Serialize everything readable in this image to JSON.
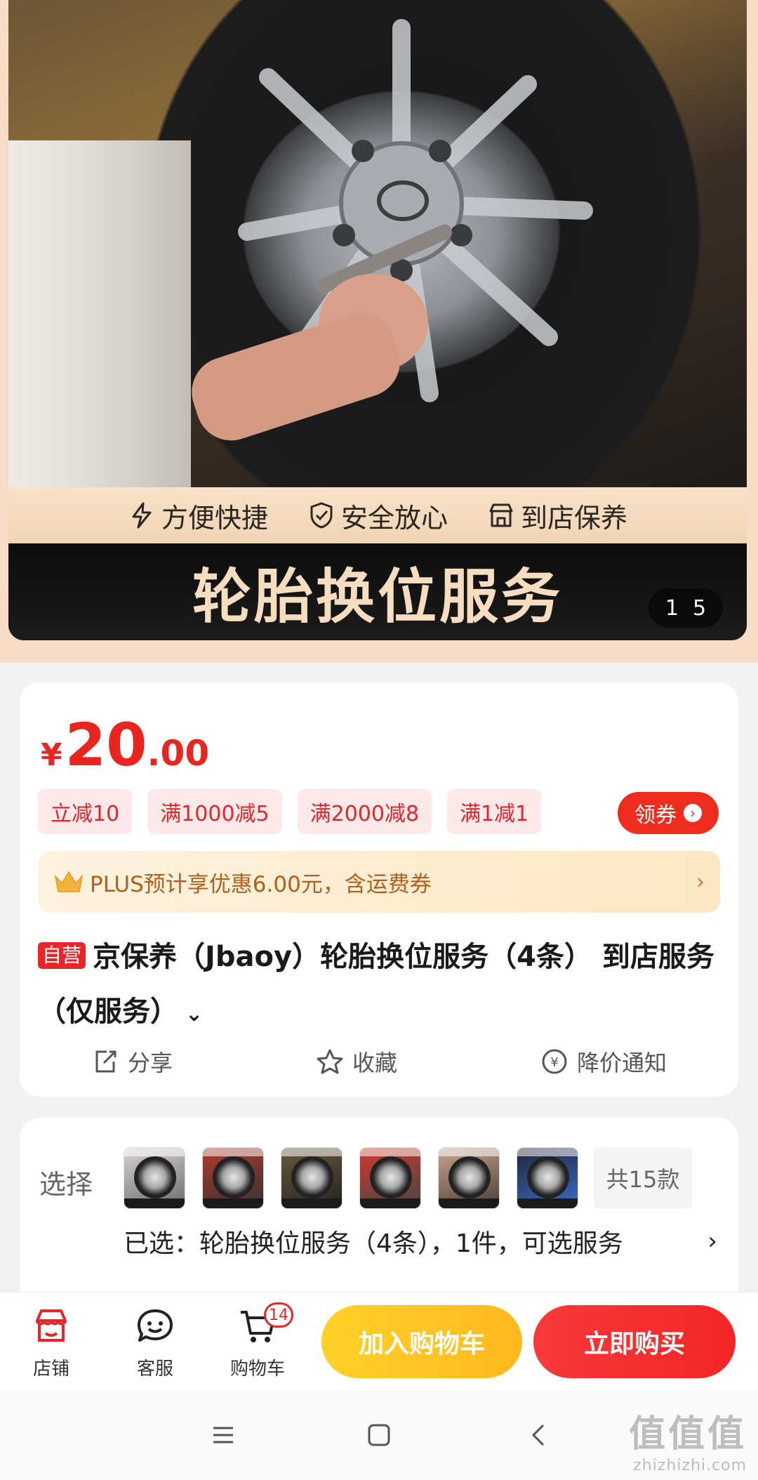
{
  "hero": {
    "features": [
      {
        "icon": "lightning-icon",
        "label": "方便快捷"
      },
      {
        "icon": "shield-check-icon",
        "label": "安全放心"
      },
      {
        "icon": "store-icon",
        "label": "到店保养"
      }
    ],
    "banner_title": "轮胎换位服务",
    "pager": {
      "current": "1",
      "total": "5"
    }
  },
  "price": {
    "currency": "¥",
    "integer": "20",
    "decimal": ".00"
  },
  "promotions": [
    "立减10",
    "满1000减5",
    "满2000减8",
    "满1减1"
  ],
  "coupon_button": {
    "label": "领券",
    "icon": "chevron-right-circle-icon"
  },
  "plus_bar": {
    "icon": "crown-icon",
    "text": "PLUS预计享优惠6.00元，含运费券",
    "chevron": "›"
  },
  "product": {
    "tag": "自营",
    "title": "京保养（Jbaoy）轮胎换位服务（4条） 到店服务（仅服务）",
    "expand_icon": "⌄"
  },
  "actions": [
    {
      "icon": "share-icon",
      "label": "分享"
    },
    {
      "icon": "star-icon",
      "label": "收藏"
    },
    {
      "icon": "price-drop-icon",
      "label": "降价通知"
    }
  ],
  "selection": {
    "label": "选择",
    "thumbnail_count_label": "共15款",
    "selected_text": "已选：轮胎换位服务（4条），1件，可选服务",
    "chevron": "›"
  },
  "bottom_bar": {
    "store_label": "店铺",
    "service_label": "客服",
    "cart_label": "购物车",
    "cart_badge": "14",
    "add_to_cart": "加入购物车",
    "buy_now": "立即购买"
  },
  "watermark": {
    "big": "值值值",
    "small": "zhizhizhi.com"
  },
  "colors": {
    "accent_red": "#e8262a",
    "price_red": "#e8261f",
    "cart_yellow": "#ffc21f",
    "plus_gold": "#b0601c",
    "banner_text": "#f6ddbf"
  }
}
